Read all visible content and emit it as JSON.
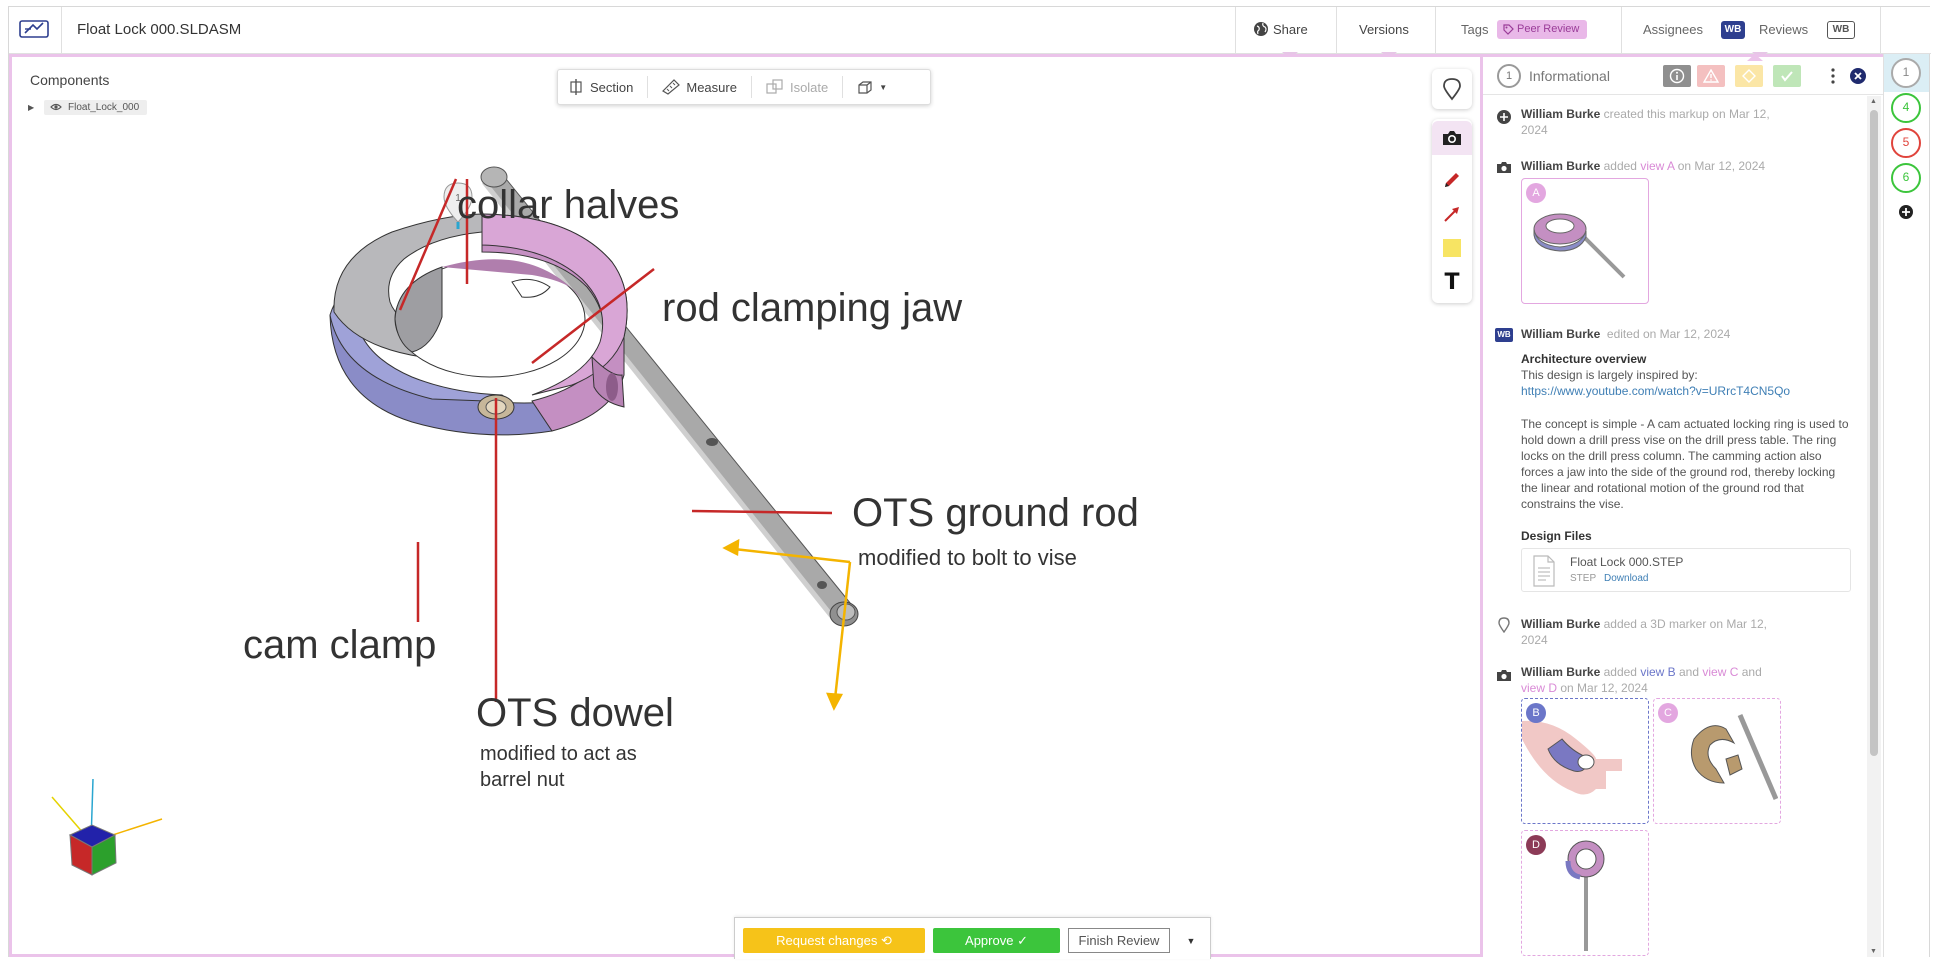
{
  "header": {
    "doc_title": "Float Lock 000.SLDASM",
    "share": "Share",
    "versions": "Versions",
    "tags_label": "Tags",
    "tag": "Peer Review",
    "assignees_label": "Assignees",
    "assignee": "WB",
    "reviews_label": "Reviews",
    "reviewer": "WB"
  },
  "components": {
    "title": "Components",
    "items": [
      "Float_Lock_000"
    ]
  },
  "toolbar": {
    "section": "Section",
    "measure": "Measure",
    "isolate": "Isolate"
  },
  "annotations": {
    "collar_halves": "collar halves",
    "rod_clamping_jaw": "rod clamping jaw",
    "ots_ground_rod": "OTS ground rod",
    "ots_ground_rod_note": "modified to bolt to vise",
    "cam_clamp": "cam clamp",
    "ots_dowel": "OTS dowel",
    "ots_dowel_note_1": "modified to act as",
    "ots_dowel_note_2": "barrel nut",
    "marker_number": "1"
  },
  "bottom_bar": {
    "request_changes": "Request changes ⟲",
    "approve": "Approve ✓",
    "finish_review": "Finish Review"
  },
  "panel": {
    "status_number": "1",
    "status_label": "Informational",
    "events": [
      {
        "user": "William Burke",
        "pre": "created this markup on Mar 12,",
        "line2": "2024"
      },
      {
        "user": "William Burke",
        "pre": "added",
        "view": "view A",
        "post": "on Mar 12, 2024",
        "thumb_letter": "A"
      },
      {
        "user": "William Burke",
        "pre": "edited on Mar 12, 2024",
        "badge": "WB"
      },
      {
        "user": "William Burke",
        "pre": "added a 3D marker on Mar 12,",
        "line2": "2024"
      },
      {
        "user": "William Burke",
        "pre": "added",
        "view_b": "view B",
        "and1": "and",
        "view_c": "view C",
        "and2": "and",
        "view_d": "view D",
        "post": "on Mar 12, 2024",
        "thumbs": [
          "B",
          "C",
          "D"
        ]
      }
    ],
    "note": {
      "title": "Architecture overview",
      "intro": "This design is largely inspired by:",
      "link": "https://www.youtube.com/watch?v=URrcT4CN5Qo",
      "body": "The concept is simple - A cam actuated locking ring is used to hold down a drill press vise on the drill press table. The ring locks on the drill press column. The camming action also forces a jaw into the side of the ground rod, thereby locking the linear and rotational motion of the ground rod that constrains the vise.",
      "files_title": "Design Files",
      "file_name": "Float Lock 000.STEP",
      "file_type": "STEP",
      "file_download": "Download"
    }
  },
  "reviews": [
    "1",
    "4",
    "5",
    "6"
  ],
  "colors": {
    "accent_pink": "#ebc3ea",
    "request_yellow": "#f6c319",
    "approve_green": "#3cc53c",
    "annotation_red": "#c62828",
    "annotation_yellow": "#f4b400"
  }
}
